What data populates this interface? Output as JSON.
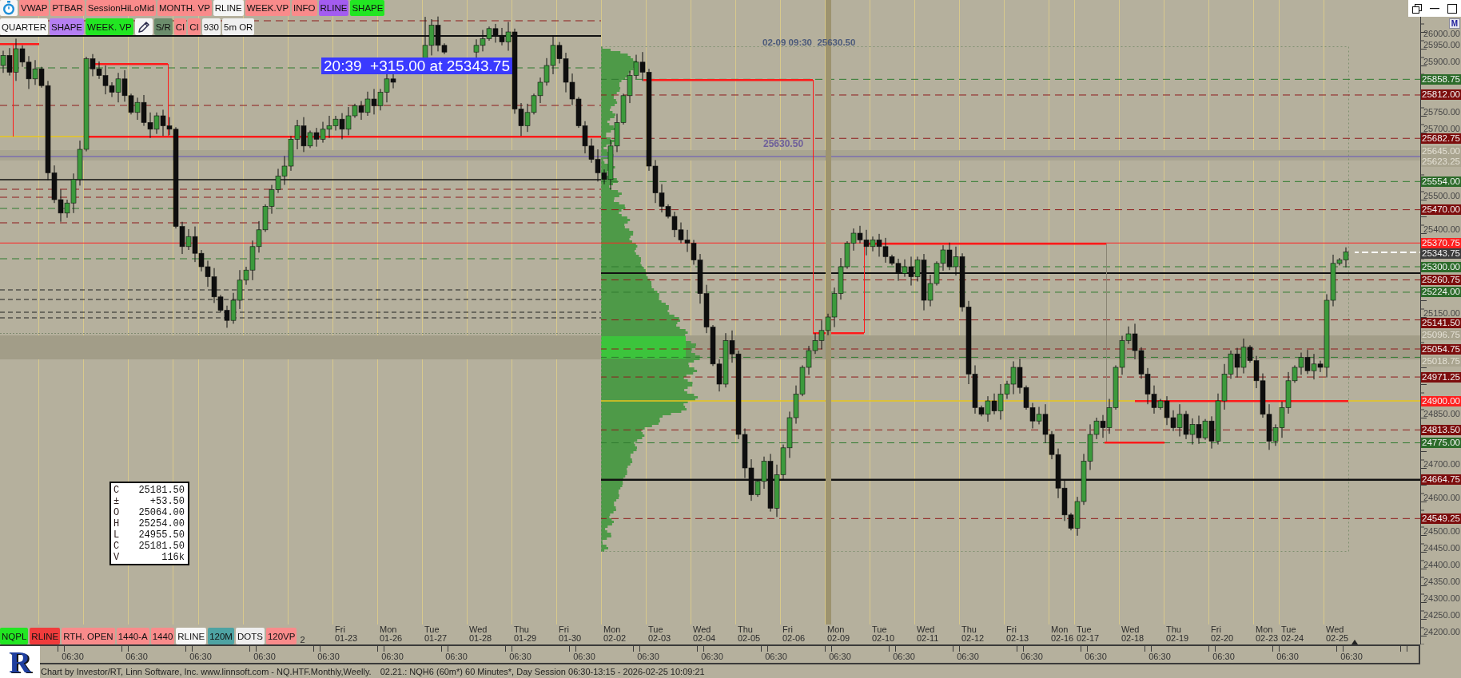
{
  "toolbar_top": [
    {
      "label": "VWAP",
      "color": "#f98b8b"
    },
    {
      "label": "PTBAR",
      "color": "#f98b8b"
    },
    {
      "label": "SessionHiLoMid",
      "color": "#f98b8b"
    },
    {
      "label": "MONTH. VP",
      "color": "#f98b8b"
    },
    {
      "label": "RLINE",
      "color": "#f6f6f6"
    },
    {
      "label": "WEEK.VP",
      "color": "#f98b8b"
    },
    {
      "label": "INFO",
      "color": "#f98b8b"
    },
    {
      "label": "RLINE",
      "color": "#a35cf0"
    },
    {
      "label": "SHAPE",
      "color": "#22e622"
    }
  ],
  "toolbar_second": [
    {
      "kind": "text",
      "label": "QUARTER",
      "color": "#f6f6f6"
    },
    {
      "kind": "text",
      "label": "SHAPE",
      "color": "#b57ff2"
    },
    {
      "kind": "text",
      "label": "WEEK. VP",
      "color": "#22e622"
    },
    {
      "kind": "tool",
      "color": "#f6f6f6"
    },
    {
      "kind": "text",
      "label": "S/R",
      "color": "#6b8c6c"
    },
    {
      "kind": "text",
      "label": "CI",
      "color": "#f98b8b"
    },
    {
      "kind": "text",
      "label": "CI",
      "color": "#f98b8b"
    },
    {
      "kind": "text",
      "label": "930",
      "color": "#f0f0f0"
    },
    {
      "kind": "text",
      "label": "5m OR",
      "color": "#f0f0f0"
    }
  ],
  "info_tag": "20:39  +315.00 at 25343.75",
  "crosshair_label": "02-09 09:30  25630.50",
  "crosshair_price": "25630.50",
  "ohlc_box": [
    {
      "key": "C",
      "value": "25181.50"
    },
    {
      "key": "±",
      "value": "+53.50"
    },
    {
      "key": "O",
      "value": "25064.00"
    },
    {
      "key": "H",
      "value": "25254.00"
    },
    {
      "key": "L",
      "value": "24955.50"
    },
    {
      "key": "C",
      "value": "25181.50"
    },
    {
      "key": "V",
      "value": "116k"
    }
  ],
  "bottom_toolbar": [
    {
      "label": "NQPL",
      "color": "#22e622"
    },
    {
      "label": "RLINE",
      "color": "#f03c3c"
    },
    {
      "label": "RTH. OPEN",
      "color": "#f98b8b"
    },
    {
      "label": "1440-A",
      "color": "#f98b8b"
    },
    {
      "label": "1440",
      "color": "#f98b8b"
    },
    {
      "label": "RLINE",
      "color": "#f6f6f6"
    },
    {
      "label": "120M",
      "color": "#4ea3a3"
    },
    {
      "label": "DOTS",
      "color": "#eeeeee"
    },
    {
      "label": "120VP",
      "color": "#f98b8b"
    }
  ],
  "time_axis": {
    "cut_date": "2",
    "dates": [
      {
        "day": "Fri",
        "date": "01-23"
      },
      {
        "day": "Mon",
        "date": "01-26"
      },
      {
        "day": "Tue",
        "date": "01-27"
      },
      {
        "day": "Wed",
        "date": "01-28"
      },
      {
        "day": "Thu",
        "date": "01-29"
      },
      {
        "day": "Fri",
        "date": "01-30"
      },
      {
        "day": "Mon",
        "date": "02-02"
      },
      {
        "day": "Tue",
        "date": "02-03"
      },
      {
        "day": "Wed",
        "date": "02-04"
      },
      {
        "day": "Thu",
        "date": "02-05"
      },
      {
        "day": "Fri",
        "date": "02-06"
      },
      {
        "day": "Mon",
        "date": "02-09"
      },
      {
        "day": "Tue",
        "date": "02-10"
      },
      {
        "day": "Wed",
        "date": "02-11"
      },
      {
        "day": "Thu",
        "date": "02-12"
      },
      {
        "day": "Fri",
        "date": "02-13"
      },
      {
        "day": "Mon",
        "date": "02-16"
      },
      {
        "day": "Tue",
        "date": "02-17"
      },
      {
        "day": "Wed",
        "date": "02-18"
      },
      {
        "day": "Thu",
        "date": "02-19"
      },
      {
        "day": "Fri",
        "date": "02-20"
      },
      {
        "day": "Mon",
        "date": "02-23"
      },
      {
        "day": "Tue",
        "date": "02-24"
      },
      {
        "day": "Wed",
        "date": "02-25"
      }
    ],
    "session_times": [
      "06:30",
      "06:30",
      "06:30",
      "06:30",
      "06:30",
      "06:30",
      "06:30",
      "06:30",
      "06:30",
      "06:30",
      "06:30",
      "06:30",
      "06:30",
      "06:30",
      "06:30",
      "06:30",
      "06:30",
      "06:30",
      "06:30",
      "06:30",
      "06:30"
    ]
  },
  "price_axis": {
    "button": "M",
    "ticks": [
      "26000.00",
      "25950.00",
      "25900.00",
      "25750.00",
      "25700.00",
      "25500.00",
      "25400.00",
      "25150.00",
      "24850.00",
      "24700.00",
      "24600.00",
      "24500.00",
      "24450.00",
      "24400.00",
      "24350.00",
      "24300.00",
      "24250.00",
      "24200.00"
    ],
    "levels": [
      {
        "price": "25858.75",
        "color": "#2c6b2a"
      },
      {
        "price": "25812.00",
        "color": "#7c0d0d"
      },
      {
        "price": "25682.75",
        "color": "#7c0d0d"
      },
      {
        "price": "25645.00",
        "color": "#a9a48f"
      },
      {
        "price": "25623.25",
        "color": "#a9a48f"
      },
      {
        "price": "25554.00",
        "color": "#2c6b2a"
      },
      {
        "price": "25470.00",
        "color": "#7c0d0d"
      },
      {
        "price": "25370.75",
        "color": "#ff1f1f"
      },
      {
        "price": "25343.75",
        "color": "#3c3c3c"
      },
      {
        "price": "25300.00",
        "color": "#2c6b2a"
      },
      {
        "price": "25260.75",
        "color": "#7c0d0d"
      },
      {
        "price": "25224.00",
        "color": "#2c6b2a"
      },
      {
        "price": "25141.50",
        "color": "#7c0d0d"
      },
      {
        "price": "25096.75",
        "color": "#a9a48f"
      },
      {
        "price": "25054.75",
        "color": "#7c0d0d"
      },
      {
        "price": "25018.75",
        "color": "#a9a48f"
      },
      {
        "price": "24971.25",
        "color": "#7c0d0d"
      },
      {
        "price": "24900.00",
        "color": "#ff1f1f"
      },
      {
        "price": "24813.50",
        "color": "#7c0d0d"
      },
      {
        "price": "24775.00",
        "color": "#2c6b2a"
      },
      {
        "price": "24664.75",
        "color": "#7c0d0d"
      },
      {
        "price": "24549.25",
        "color": "#7c0d0d"
      }
    ]
  },
  "footer": {
    "logo": "R",
    "credit": "Chart by Investor/RT, Linn Software, Inc. www.linnsoft.com - NQ.HTF.Monthly,Weelly.",
    "status": "02.21.: NQH6 (60m*) 60 Minutes*, Day Session 06:30-13:15 - 2026-02-25 10:09:21"
  }
}
